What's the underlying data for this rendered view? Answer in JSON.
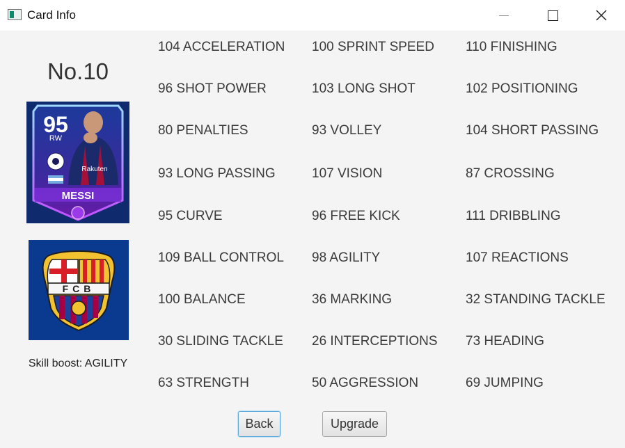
{
  "window": {
    "title": "Card Info"
  },
  "player": {
    "number": "No.10",
    "card": {
      "rating": "95",
      "position": "RW",
      "name": "MESSI",
      "sponsor": "Rakuten"
    },
    "club_crest": "FCB",
    "skill_boost": "Skill boost: AGILITY"
  },
  "stats": [
    "104 ACCELERATION",
    "100 SPRINT SPEED",
    "110 FINISHING",
    "96 SHOT POWER",
    "103 LONG SHOT",
    "102 POSITIONING",
    "80 PENALTIES",
    "93 VOLLEY",
    "104 SHORT PASSING",
    "93 LONG PASSING",
    "107 VISION",
    "87 CROSSING",
    "95 CURVE",
    "96 FREE KICK",
    "111 DRIBBLING",
    "109 BALL CONTROL",
    "98 AGILITY",
    "107 REACTIONS",
    "100 BALANCE",
    "36 MARKING",
    "32 STANDING TACKLE",
    "30 SLIDING TACKLE",
    "26 INTERCEPTIONS",
    "73 HEADING",
    "63 STRENGTH",
    "50 AGGRESSION",
    "69 JUMPING"
  ],
  "buttons": {
    "back": "Back",
    "upgrade": "Upgrade"
  },
  "colors": {
    "card_frame": "#7a2fd6",
    "crest_background": "#0a3a8f",
    "focus_ring": "#5aa9dd"
  },
  "icons": {
    "minimize": "minimize-icon",
    "maximize": "maximize-icon",
    "close": "close-icon"
  }
}
